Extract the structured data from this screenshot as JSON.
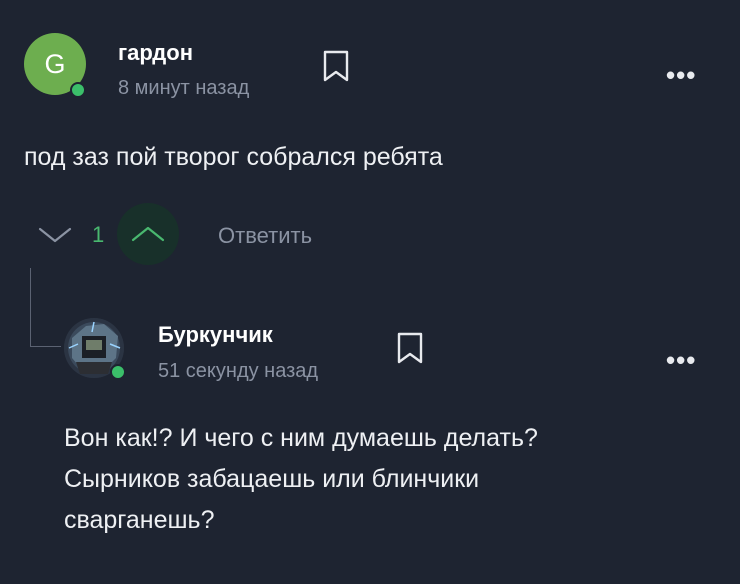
{
  "comment": {
    "avatar_letter": "G",
    "username": "гардон",
    "time": "8 минут назад",
    "text": "под заз пой творог собрался ребята",
    "more": "•••",
    "vote_count": "1",
    "reply_label": "Ответить"
  },
  "reply_comment": {
    "username": "Буркунчик",
    "time": "51 секунду назад",
    "text_lines": [
      "Вон как!? И чего с ним думаешь делать?",
      "Сырников забацаешь или блинчики",
      "сварганешь?"
    ],
    "more": "•••"
  },
  "colors": {
    "background": "#1e2431",
    "avatar_green": "#6dae4f",
    "vote_green": "#49b86f",
    "muted": "#8b93a3"
  }
}
